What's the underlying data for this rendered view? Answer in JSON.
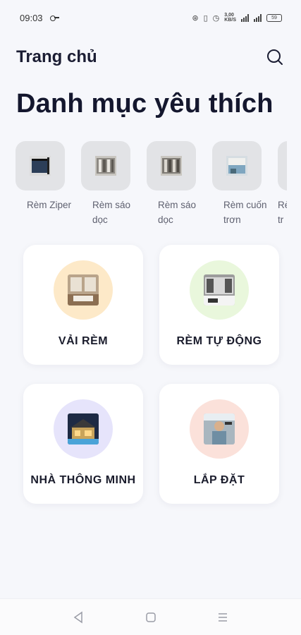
{
  "status_bar": {
    "time": "09:03",
    "speed": "3,00\nKB/S",
    "battery": "59"
  },
  "header": {
    "title": "Trang chủ",
    "search_icon": "search-icon"
  },
  "favorites": {
    "title": "Danh mục yêu thích",
    "items": [
      {
        "label": "Rèm Ziper",
        "icon": "zipper-blind-photo"
      },
      {
        "label": "Rèm sáo dọc",
        "icon": "vertical-blind-photo"
      },
      {
        "label": "Rèm sáo dọc",
        "icon": "vertical-blind-photo"
      },
      {
        "label": "Rèm cuốn trơn",
        "icon": "roller-blind-photo"
      },
      {
        "label": "Rè tr",
        "icon": "blind-photo"
      }
    ]
  },
  "categories": [
    {
      "label": "VẢI RÈM",
      "circle_color": "#fde9c8",
      "icon": "fabric-curtain-photo"
    },
    {
      "label": "RÈM TỰ ĐỘNG",
      "circle_color": "#e9f7dc",
      "icon": "automatic-curtain-photo"
    },
    {
      "label": "NHÀ THÔNG MINH",
      "circle_color": "#e6e4fb",
      "icon": "smart-home-photo"
    },
    {
      "label": "LẮP ĐẶT",
      "circle_color": "#fbe1da",
      "icon": "installation-photo"
    }
  ],
  "nav_bar": {
    "back": "back-icon",
    "home": "home-icon",
    "menu": "menu-icon"
  }
}
